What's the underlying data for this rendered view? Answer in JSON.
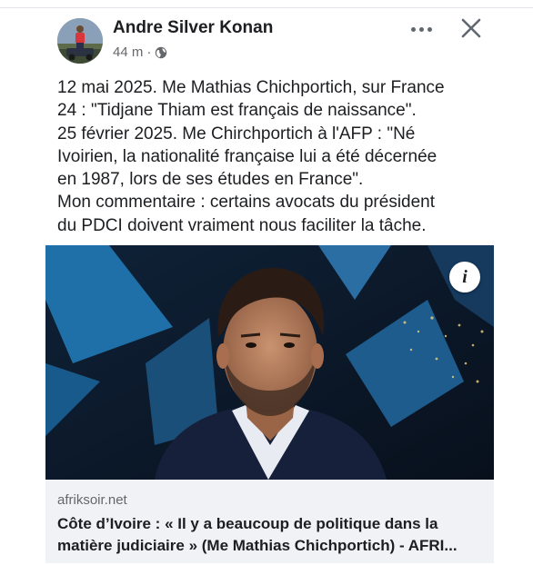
{
  "post": {
    "author": "Andre Silver Konan",
    "time": "44 m",
    "separator": "·",
    "audience_icon": "globe-icon",
    "text_lines": [
      "12 mai 2025. Me Mathias Chichportich, sur France",
      "24 : \"Tidjane Thiam est français de naissance\".",
      "25 février 2025. Me Chirchportich à l'AFP : \"Né",
      "Ivoirien, la nationalité française lui a été décernée",
      "en 1987, lors de ses études en France\".",
      "Mon commentaire : certains avocats du président",
      "du PDCI doivent vraiment nous faciliter la tâche."
    ]
  },
  "header_actions": {
    "more_icon": "more-horizontal-icon",
    "close_icon": "close-icon"
  },
  "link_preview": {
    "info_label": "i",
    "domain": "afriksoir.net",
    "title_lines": [
      "Côte d’Ivoire : « Il y a beaucoup de politique dans la",
      "matière judiciaire » (Me Mathias Chichportich) - AFRI..."
    ]
  },
  "colors": {
    "text": "#1c1e21",
    "secondary": "#65676b",
    "link_footer_bg": "#f0f2f5",
    "divider": "#e4e6eb"
  }
}
